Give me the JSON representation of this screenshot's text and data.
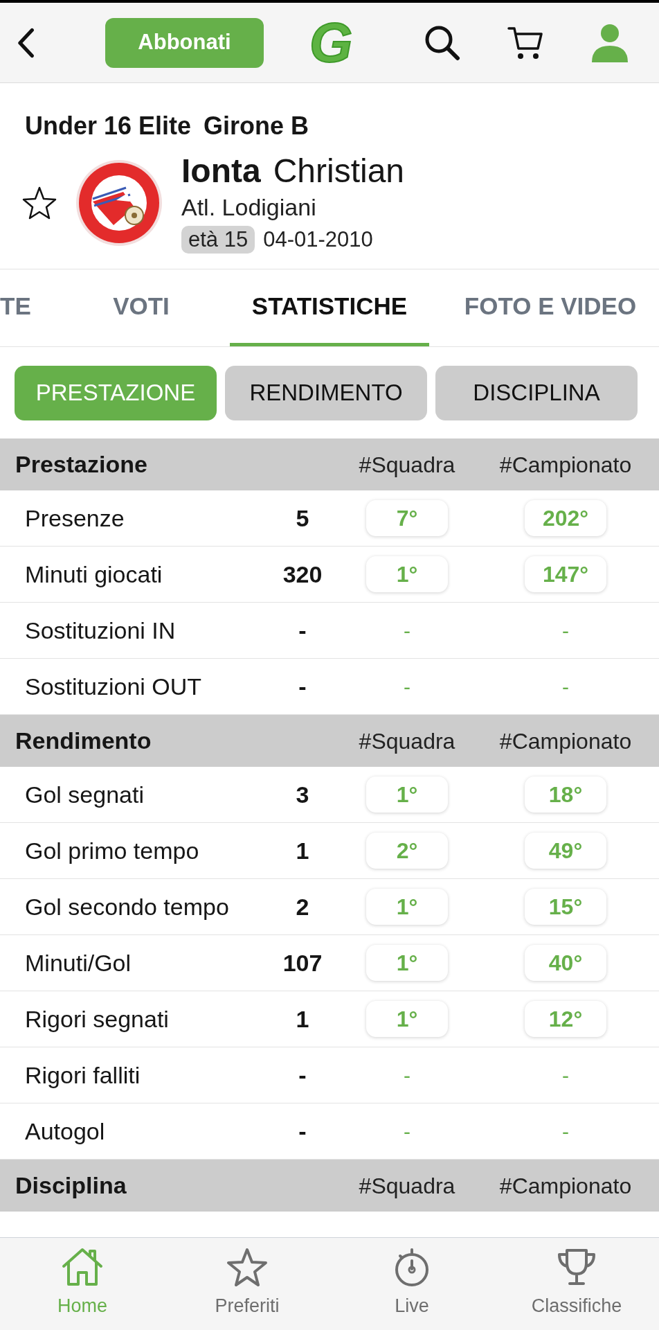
{
  "header": {
    "subscribe_button": "Abbonati",
    "logo": "G"
  },
  "competition": {
    "category": "Under 16 Elite",
    "group": "Girone B"
  },
  "player": {
    "favorite": false,
    "surname": "Ionta",
    "name": "Christian",
    "team": "Atl. Lodigiani",
    "age": "età 15",
    "birth_date": "04-01-2010"
  },
  "tabs": [
    {
      "label": "TE",
      "selected": false
    },
    {
      "label": "VOTI",
      "selected": false
    },
    {
      "label": "STATISTICHE",
      "selected": true
    },
    {
      "label": "FOTO E VIDEO",
      "selected": false
    }
  ],
  "filters": [
    {
      "label": "PRESTAZIONE",
      "selected": true
    },
    {
      "label": "RENDIMENTO",
      "selected": false
    },
    {
      "label": "DISCIPLINA",
      "selected": false
    }
  ],
  "sections": [
    {
      "title": "Prestazione",
      "columns": [
        "#Squadra",
        "#Campionato"
      ],
      "rows": [
        {
          "label": "Presenze",
          "value": "5",
          "kind": "ranked",
          "squadra": "7°",
          "campionato": "202°"
        },
        {
          "label": "Minuti giocati",
          "value": "320",
          "kind": "ranked",
          "squadra": "1°",
          "campionato": "147°"
        },
        {
          "label": "Sostituzioni IN",
          "value": "-",
          "kind": "unranked",
          "squadra": "-",
          "campionato": "-"
        },
        {
          "label": "Sostituzioni OUT",
          "value": "-",
          "kind": "unranked",
          "squadra": "-",
          "campionato": "-"
        }
      ]
    },
    {
      "title": "Rendimento",
      "columns": [
        "#Squadra",
        "#Campionato"
      ],
      "rows": [
        {
          "label": "Gol segnati",
          "value": "3",
          "kind": "ranked",
          "squadra": "1°",
          "campionato": "18°"
        },
        {
          "label": "Gol primo tempo",
          "value": "1",
          "kind": "ranked",
          "squadra": "2°",
          "campionato": "49°"
        },
        {
          "label": "Gol secondo tempo",
          "value": "2",
          "kind": "ranked",
          "squadra": "1°",
          "campionato": "15°"
        },
        {
          "label": "Minuti/Gol",
          "value": "107",
          "kind": "ranked",
          "squadra": "1°",
          "campionato": "40°"
        },
        {
          "label": "Rigori segnati",
          "value": "1",
          "kind": "ranked",
          "squadra": "1°",
          "campionato": "12°"
        },
        {
          "label": "Rigori falliti",
          "value": "-",
          "kind": "unranked",
          "squadra": "-",
          "campionato": "-"
        },
        {
          "label": "Autogol",
          "value": "-",
          "kind": "unranked",
          "squadra": "-",
          "campionato": "-"
        }
      ]
    },
    {
      "title": "Disciplina",
      "columns": [
        "#Squadra",
        "#Campionato"
      ]
    }
  ],
  "bottom_nav": [
    {
      "label": "Home",
      "selected": true
    },
    {
      "label": "Preferiti",
      "selected": false
    },
    {
      "label": "Live",
      "selected": false
    },
    {
      "label": "Classifiche",
      "selected": false
    }
  ]
}
